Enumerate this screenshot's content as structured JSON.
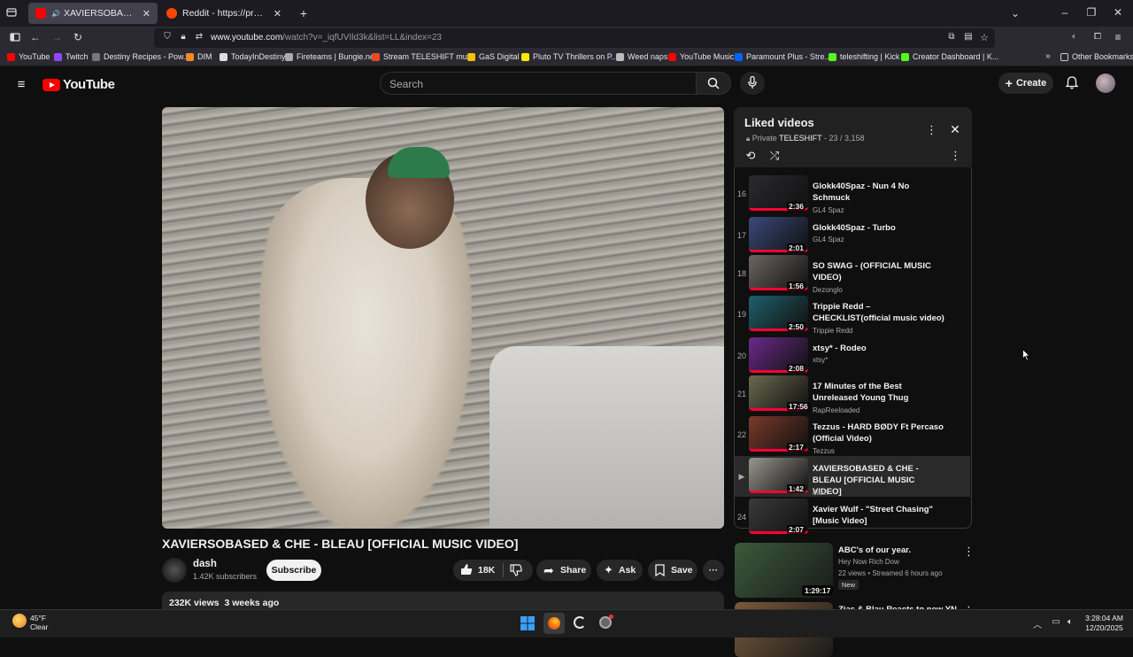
{
  "browser": {
    "tabs": [
      {
        "label": "XAVIERSOBASED & CHE - B",
        "active": true
      },
      {
        "label": "Reddit - https://preview.redd.it/",
        "active": false
      }
    ],
    "new_tab": "+",
    "url_host": "www.youtube.com",
    "url_rest": "/watch?v=_iqfUVIld3k&list=LL&index=23",
    "bookmarks": [
      {
        "label": "YouTube",
        "color": "#ff0000"
      },
      {
        "label": "Twitch",
        "color": "#9146ff"
      },
      {
        "label": "Destiny Recipes - Pow...",
        "color": "#777777"
      },
      {
        "label": "DIM",
        "color": "#f08a24"
      },
      {
        "label": "TodayInDestiny",
        "color": "#dddddd"
      },
      {
        "label": "Fireteams | Bungie.net",
        "color": "#aaaaaa"
      },
      {
        "label": "Stream TELESHIFT mu...",
        "color": "#e44d26"
      },
      {
        "label": "GaS Digital",
        "color": "#f4c20d"
      },
      {
        "label": "Pluto TV Thrillers on P...",
        "color": "#ffe900"
      },
      {
        "label": "Weed naps",
        "color": "#bbbbbb"
      },
      {
        "label": "YouTube Music",
        "color": "#ff0000"
      },
      {
        "label": "Paramount Plus - Stre...",
        "color": "#0064ff"
      },
      {
        "label": "teleshifting | Kick",
        "color": "#53fc18"
      },
      {
        "label": "Creator Dashboard | K...",
        "color": "#53fc18"
      }
    ],
    "other_bookmarks": "Other Bookmarks"
  },
  "header": {
    "logo": "YouTube",
    "search_placeholder": "Search",
    "create_label": "Create"
  },
  "video": {
    "title": "XAVIERSOBASED & CHE - BLEAU [OFFICIAL MUSIC VIDEO]",
    "channel": "dash",
    "subscribers": "1.42K subscribers",
    "subscribe_label": "Subscribe",
    "likes": "18K",
    "share_label": "Share",
    "ask_label": "Ask",
    "save_label": "Save",
    "views": "232K views",
    "date": "3 weeks ago"
  },
  "playlist": {
    "title": "Liked videos",
    "privacy": "Private",
    "owner": "TELESHIFT",
    "position": "23 / 3,158",
    "items": [
      {
        "num": "16",
        "title": "Glokk40Spaz - Nun 4 No Schmuck",
        "channel": "GL4 Spaz",
        "duration": "2:36",
        "color": "#2a2a30",
        "current": false
      },
      {
        "num": "17",
        "title": "Glokk40Spaz - Turbo",
        "channel": "GL4 Spaz",
        "duration": "2:01",
        "color": "#3a4a7a",
        "current": false
      },
      {
        "num": "18",
        "title": "SO SWAG - (OFFICIAL MUSIC VIDEO)",
        "channel": "Dezonglo",
        "duration": "1:56",
        "color": "#6c6660",
        "current": false
      },
      {
        "num": "19",
        "title": "Trippie Redd – CHECKLIST(official music video)",
        "channel": "Trippie Redd",
        "duration": "2:50",
        "color": "#1f5f6a",
        "current": false
      },
      {
        "num": "20",
        "title": "xtsy* - Rodeo",
        "channel": "xtsy*",
        "duration": "2:08",
        "color": "#6a2a8a",
        "current": false
      },
      {
        "num": "21",
        "title": "17 Minutes of the Best Unreleased Young Thug",
        "channel": "RapReeloaded",
        "duration": "17:56",
        "color": "#6a6a50",
        "current": false
      },
      {
        "num": "22",
        "title": "Tezzus - HARD BØDY Ft Percaso (Official Video)",
        "channel": "Tezzus",
        "duration": "2:17",
        "color": "#7a3a2a",
        "current": false
      },
      {
        "num": "▶",
        "title": "XAVIERSOBASED & CHE - BLEAU [OFFICIAL MUSIC VIDEO]",
        "channel": "dash",
        "duration": "1:42",
        "color": "#9a968e",
        "current": true
      },
      {
        "num": "24",
        "title": "Xavier Wulf - \"Street Chasing\" [Music Video]",
        "channel": "",
        "duration": "2:07",
        "color": "#3a3a3a",
        "current": false
      }
    ]
  },
  "recommended": [
    {
      "title": "ABC's of our year.",
      "channel": "Hey Now Rich Dow",
      "meta": "22 views • Streamed 6 hours ago",
      "badge": "New",
      "duration": "1:29:17",
      "color": "#3a5a3a"
    },
    {
      "title": "Zias & Blau Reacts to new YN",
      "channel": "",
      "meta": "",
      "badge": "",
      "duration": "",
      "color": "#7a5a3a"
    }
  ],
  "taskbar": {
    "temp": "45°F",
    "condition": "Clear",
    "time": "3:28:04 AM",
    "date": "12/20/2025"
  }
}
